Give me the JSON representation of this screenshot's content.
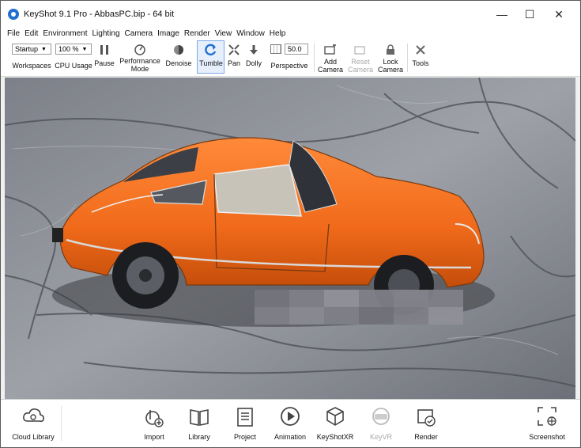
{
  "window": {
    "title": "KeyShot 9.1 Pro  - AbbasPC.bip  - 64 bit",
    "minimize": "—",
    "maximize": "☐",
    "close": "✕"
  },
  "menu": [
    "File",
    "Edit",
    "Environment",
    "Lighting",
    "Camera",
    "Image",
    "Render",
    "View",
    "Window",
    "Help"
  ],
  "toolbar": {
    "workspace_value": "Startup",
    "workspace_label": "Workspaces",
    "cpu_value": "100 %",
    "cpu_label": "CPU Usage",
    "pause_label": "Pause",
    "performance_label_1": "Performance",
    "performance_label_2": "Mode",
    "denoise_label": "Denoise",
    "tumble_label": "Tumble",
    "pan_label": "Pan",
    "dolly_label": "Dolly",
    "fov_value": "50.0",
    "perspective_label": "Perspective",
    "add_camera_1": "Add",
    "add_camera_2": "Camera",
    "reset_camera_1": "Reset",
    "reset_camera_2": "Camera",
    "lock_camera_1": "Lock",
    "lock_camera_2": "Camera",
    "tools_label": "Tools"
  },
  "bottom": {
    "cloud_library": "Cloud Library",
    "import": "Import",
    "library": "Library",
    "project": "Project",
    "animation": "Animation",
    "keyshotxr": "KeyShotXR",
    "keyvr": "KeyVR",
    "render": "Render",
    "screenshot": "Screenshot"
  },
  "colors": {
    "accent": "#1f6fd1",
    "car_body": "#f06a1a",
    "background_wood": "#8c8f96"
  }
}
